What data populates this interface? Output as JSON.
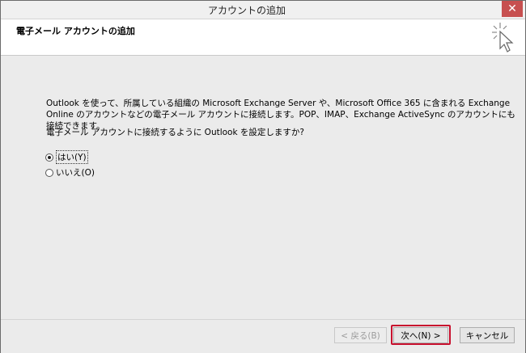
{
  "window": {
    "title": "アカウントの追加",
    "close_glyph": "✕"
  },
  "header": {
    "title": "電子メール アカウントの追加",
    "icon": "cursor-sparkle-icon"
  },
  "content": {
    "description": "Outlook を使って、所属している組織の Microsoft Exchange Server や、Microsoft Office 365 に含まれる Exchange Online のアカウントなどの電子メール アカウントに接続します。POP、IMAP、Exchange ActiveSync のアカウントにも接続できます。",
    "question": "電子メール アカウントに接続するように Outlook を設定しますか?",
    "options": [
      {
        "label": "はい(Y)",
        "checked": true
      },
      {
        "label": "いいえ(O)",
        "checked": false
      }
    ]
  },
  "footer": {
    "back_label": "< 戻る(B)",
    "next_label": "次へ(N) >",
    "cancel_label": "キャンセル",
    "highlight_color": "#c8102e"
  }
}
